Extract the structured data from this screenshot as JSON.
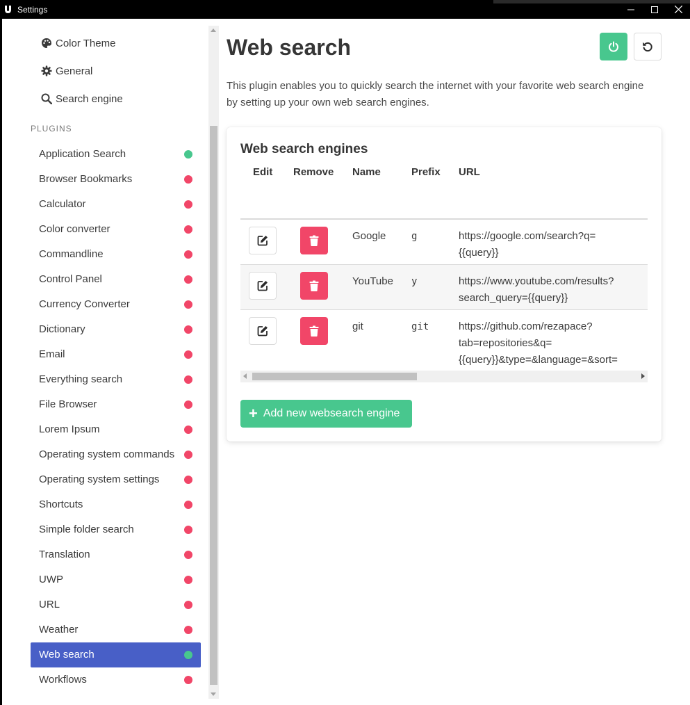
{
  "window": {
    "title": "Settings"
  },
  "sidebar": {
    "top_items": [
      {
        "label": "Color Theme",
        "icon": "palette-icon"
      },
      {
        "label": "General",
        "icon": "gear-icon"
      },
      {
        "label": "Search engine",
        "icon": "search-icon"
      }
    ],
    "plugins_heading": "PLUGINS",
    "plugins": [
      {
        "label": "Application Search",
        "enabled": true
      },
      {
        "label": "Browser Bookmarks",
        "enabled": false
      },
      {
        "label": "Calculator",
        "enabled": false
      },
      {
        "label": "Color converter",
        "enabled": false
      },
      {
        "label": "Commandline",
        "enabled": false
      },
      {
        "label": "Control Panel",
        "enabled": false
      },
      {
        "label": "Currency Converter",
        "enabled": false
      },
      {
        "label": "Dictionary",
        "enabled": false
      },
      {
        "label": "Email",
        "enabled": false
      },
      {
        "label": "Everything search",
        "enabled": false
      },
      {
        "label": "File Browser",
        "enabled": false
      },
      {
        "label": "Lorem Ipsum",
        "enabled": false
      },
      {
        "label": "Operating system commands",
        "enabled": false
      },
      {
        "label": "Operating system settings",
        "enabled": false
      },
      {
        "label": "Shortcuts",
        "enabled": false
      },
      {
        "label": "Simple folder search",
        "enabled": false
      },
      {
        "label": "Translation",
        "enabled": false
      },
      {
        "label": "UWP",
        "enabled": false
      },
      {
        "label": "URL",
        "enabled": false
      },
      {
        "label": "Weather",
        "enabled": false
      },
      {
        "label": "Web search",
        "enabled": true,
        "active": true
      },
      {
        "label": "Workflows",
        "enabled": false
      }
    ]
  },
  "colors": {
    "enabled_dot": "#48c78e",
    "disabled_dot": "#f14668",
    "active_item_bg": "#485fc7",
    "primary_green": "#48c78e",
    "danger_red": "#f14668"
  },
  "main": {
    "title": "Web search",
    "power_icon": "power-icon",
    "reset_icon": "undo-icon",
    "description": "This plugin enables you to quickly search the internet with your favorite web search engine by setting up your own web search engines.",
    "card": {
      "title": "Web search engines",
      "columns": [
        "Edit",
        "Remove",
        "Name",
        "Prefix",
        "URL"
      ],
      "rows": [
        {
          "name": "Google",
          "prefix": "g",
          "url_lines": [
            "https://google.com/search?q=",
            "{{query}}"
          ]
        },
        {
          "name": "YouTube",
          "prefix": "y",
          "url_lines": [
            "https://www.youtube.com/results?",
            "search_query={{query}}"
          ]
        },
        {
          "name": "git",
          "prefix": "git",
          "url_lines": [
            "https://github.com/rezapace?",
            "tab=repositories&q=",
            "{{query}}&type=&language=&sort="
          ]
        }
      ],
      "add_button": "Add new websearch engine"
    }
  }
}
